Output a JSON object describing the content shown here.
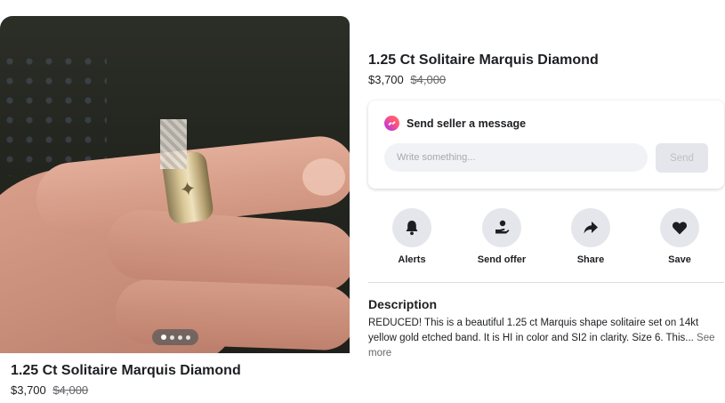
{
  "listing": {
    "title": "1.25 Ct Solitaire Marquis Diamond",
    "price": "$3,700",
    "original_price": "$4,000"
  },
  "photo": {
    "carousel_dots": 4,
    "active_dot": 0
  },
  "message": {
    "heading": "Send seller a message",
    "placeholder": "Write something...",
    "send_label": "Send",
    "icon": "messenger-icon"
  },
  "actions": [
    {
      "label": "Alerts",
      "icon": "bell-icon"
    },
    {
      "label": "Send offer",
      "icon": "send-offer-icon"
    },
    {
      "label": "Share",
      "icon": "share-arrow-icon"
    },
    {
      "label": "Save",
      "icon": "heart-icon"
    }
  ],
  "description": {
    "heading": "Description",
    "text": "REDUCED! This is a beautiful 1.25 ct Marquis shape solitaire set on 14kt yellow gold etched band. It is HI in color and SI2 in clarity. Size 6. This...",
    "see_more": "See more"
  },
  "colors": {
    "text": "#1c1e21",
    "muted": "#65676b",
    "button_bg": "#e4e6eb",
    "input_bg": "#f0f2f5"
  }
}
